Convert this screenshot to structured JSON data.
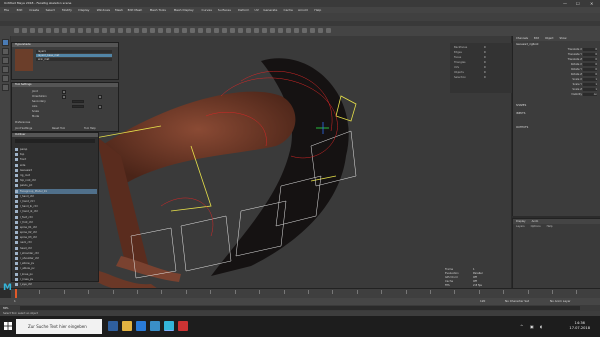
{
  "window": {
    "title": "Untitled Maya 2018 - FaceRig skeleton scene",
    "min": "—",
    "max": "☐",
    "close": "✕"
  },
  "menubar": [
    "File",
    "Edit",
    "Create",
    "Select",
    "Modify",
    "Display",
    "Windows",
    "Mesh",
    "Edit Mesh",
    "Mesh Tools",
    "Mesh Display",
    "Curves",
    "Surfaces",
    "Deform",
    "UV",
    "Generate",
    "Cache",
    "Arnold",
    "Help"
  ],
  "image_window": {
    "title": "Hypershade",
    "rows": [
      "layer1",
      "layer2_base_mat",
      "skin_mat"
    ],
    "selected_row": 1
  },
  "tool_window": {
    "title": "Tool Settings",
    "labels": [
      "Joint",
      "Orientation",
      "Secondary",
      "Axis",
      "Scale",
      "Mode",
      "Preferences"
    ],
    "footer": [
      "Joint Settings",
      "Reset Tool",
      "Tool Help"
    ]
  },
  "outliner": {
    "title": "Outliner",
    "items": [
      "persp",
      "top",
      "front",
      "side",
      "Genesis3",
      "rig_root",
      "hip_root_ctrl",
      "pelvis_jnt",
      "Facegroup_Model_01",
      "l_hand_ctrl",
      "r_hand_ctrl",
      "l_hand_ik_ctrl",
      "r_hand_ik_ctrl",
      "l_foot_ctrl",
      "r_foot_ctrl",
      "spine_01_ctrl",
      "spine_02_ctrl",
      "spine_03_ctrl",
      "neck_ctrl",
      "head_ctrl",
      "l_shoulder_ctrl",
      "r_shoulder_ctrl",
      "l_elbow_pv",
      "r_elbow_pv",
      "l_knee_pv",
      "r_knee_pv",
      "l_eye_ctrl",
      "r_eye_ctrl",
      "jaw_ctrl",
      "defaultLightSet",
      "defaultObjectSet"
    ],
    "selected": 8
  },
  "mid_panel": {
    "rows": [
      [
        "Backfaces",
        "0"
      ],
      [
        "Edges",
        "0"
      ],
      [
        "Faces",
        "0"
      ],
      [
        "Triangles",
        "0"
      ],
      [
        "UVs",
        "0"
      ],
      [
        "Objects",
        "0"
      ],
      [
        "Selection",
        "0"
      ]
    ]
  },
  "channel_box": {
    "tabs": [
      "Channels",
      "Edit",
      "Object",
      "Show"
    ],
    "node": "Genesis3_rigRoot",
    "attrs": [
      [
        "Translate X",
        "0"
      ],
      [
        "Translate Y",
        "0"
      ],
      [
        "Translate Z",
        "0"
      ],
      [
        "Rotate X",
        "0"
      ],
      [
        "Rotate Y",
        "0"
      ],
      [
        "Rotate Z",
        "0"
      ],
      [
        "Scale X",
        "1"
      ],
      [
        "Scale Y",
        "1"
      ],
      [
        "Scale Z",
        "1"
      ],
      [
        "Visibility",
        "on"
      ]
    ],
    "shapes_label": "SHAPES",
    "inputs_label": "INPUTS",
    "outputs_label": "OUTPUTS"
  },
  "layers": {
    "tabs": [
      "Display",
      "Anim"
    ],
    "menu": [
      "Layers",
      "Options",
      "Help"
    ]
  },
  "hud": {
    "rows": [
      [
        "Frame",
        "1"
      ],
      [
        "Evaluation",
        "Parallel"
      ],
      [
        "GPU Ovrd",
        "Off"
      ],
      [
        "Cache",
        "Off"
      ],
      [
        "FPS",
        "2.8 fps"
      ]
    ]
  },
  "viewport": {
    "camera": "persp"
  },
  "timeline": {
    "current_frame": 1,
    "start": 1,
    "end": 120
  },
  "rangebar": {
    "start_label": "1",
    "end_label": "120",
    "char_set": "No Character Set",
    "anim_layer": "No Anim Layer"
  },
  "cmdline": {
    "label": "MEL"
  },
  "help": {
    "message": "Select Tool: select an object"
  },
  "logo": "M",
  "taskbar": {
    "search_placeholder": "Zur Suche Text hier eingeben",
    "time": "14:36",
    "date": "17.07.2018"
  },
  "colors": {
    "accent": "#5285a6",
    "timeline_cursor": "#e05a2a",
    "maya_logo": "#34b5d9"
  }
}
